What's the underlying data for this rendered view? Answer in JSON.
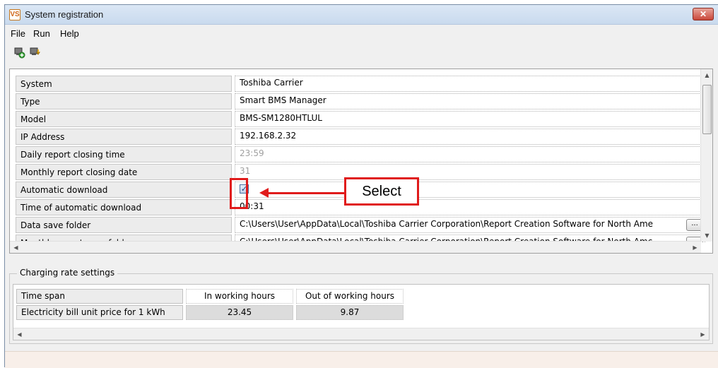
{
  "window": {
    "title": "System registration",
    "app_icon_text": "VS",
    "close_symbol": "✕"
  },
  "menu": [
    "File",
    "Run",
    "Help"
  ],
  "toolbar": {
    "icons": [
      "add-computer-icon",
      "download-computer-icon"
    ]
  },
  "settings": {
    "rows": [
      {
        "label": "System",
        "value": "Toshiba Carrier"
      },
      {
        "label": "Type",
        "value": "Smart BMS Manager"
      },
      {
        "label": "Model",
        "value": "BMS-SM1280HTLUL"
      },
      {
        "label": "IP Address",
        "value": "192.168.2.32"
      },
      {
        "label": "Daily report closing time",
        "value": "23:59"
      },
      {
        "label": "Monthly report closing date",
        "value": "31"
      },
      {
        "label": "Automatic download",
        "value": "",
        "checked": true
      },
      {
        "label": "Time of automatic download",
        "value": "00:31"
      },
      {
        "label": "Data save folder",
        "value": "C:\\Users\\User\\AppData\\Local\\Toshiba Carrier Corporation\\Report Creation Software for North Ame",
        "browse": "..."
      },
      {
        "label": "Monthly report save folder",
        "value": "C:\\Users\\User\\AppData\\Local\\Toshiba Carrier Corporation\\Report Creation Software for North Amc",
        "browse": "..."
      }
    ]
  },
  "annotation": {
    "label": "Select",
    "color": "#e01b1b"
  },
  "charging": {
    "group_title": "Charging rate settings",
    "row_label_time": "Time span",
    "row_label_price": "Electricity bill unit price for 1 kWh",
    "col_in": "In working hours",
    "col_out": "Out of working hours",
    "price_in": "23.45",
    "price_out": "9.87"
  }
}
